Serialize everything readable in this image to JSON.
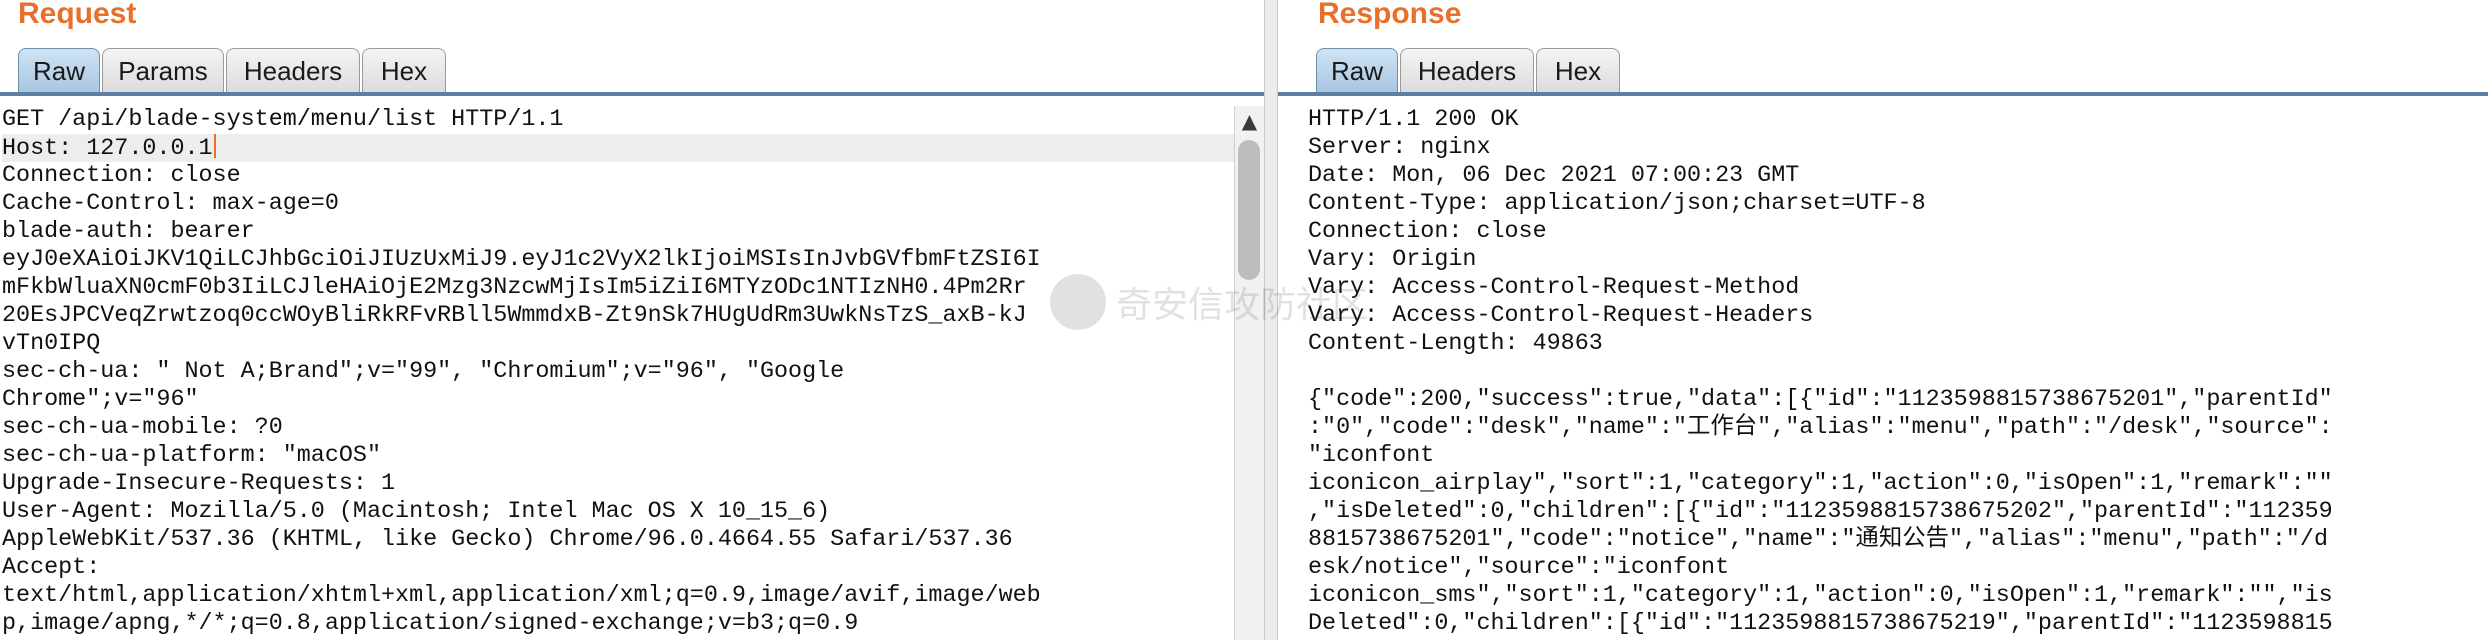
{
  "request": {
    "title": "Request",
    "tabs": [
      {
        "label": "Raw",
        "active": true
      },
      {
        "label": "Params",
        "active": false
      },
      {
        "label": "Headers",
        "active": false
      },
      {
        "label": "Hex",
        "active": false
      }
    ],
    "lines": [
      "GET /api/blade-system/menu/list HTTP/1.1",
      "Host: 127.0.0.1",
      "Connection: close",
      "Cache-Control: max-age=0",
      "blade-auth: bearer",
      "eyJ0eXAiOiJKV1QiLCJhbGciOiJIUzUxMiJ9.eyJ1c2VyX2lkIjoiMSIsInJvbGVfbmFtZSI6I",
      "mFkbWluaXN0cmF0b3IiLCJleHAiOjE2Mzg3NzcwMjIsIm5iZiI6MTYzODc1NTIzNH0.4Pm2Rr",
      "20EsJPCVeqZrwtzoq0ccWOyBliRkRFvRBll5WmmdxB-Zt9nSk7HUgUdRm3UwkNsTzS_axB-kJ",
      "vTn0IPQ",
      "sec-ch-ua: \" Not A;Brand\";v=\"99\", \"Chromium\";v=\"96\", \"Google",
      "Chrome\";v=\"96\"",
      "sec-ch-ua-mobile: ?0",
      "sec-ch-ua-platform: \"macOS\"",
      "Upgrade-Insecure-Requests: 1",
      "User-Agent: Mozilla/5.0 (Macintosh; Intel Mac OS X 10_15_6)",
      "AppleWebKit/537.36 (KHTML, like Gecko) Chrome/96.0.4664.55 Safari/537.36",
      "Accept:",
      "text/html,application/xhtml+xml,application/xml;q=0.9,image/avif,image/web",
      "p,image/apng,*/*;q=0.8,application/signed-exchange;v=b3;q=0.9"
    ],
    "highlighted_line": 1,
    "scroll_up_icon": "scroll-up-arrow-icon"
  },
  "response": {
    "title": "Response",
    "tabs": [
      {
        "label": "Raw",
        "active": true
      },
      {
        "label": "Headers",
        "active": false
      },
      {
        "label": "Hex",
        "active": false
      }
    ],
    "lines": [
      "HTTP/1.1 200 OK",
      "Server: nginx",
      "Date: Mon, 06 Dec 2021 07:00:23 GMT",
      "Content-Type: application/json;charset=UTF-8",
      "Connection: close",
      "Vary: Origin",
      "Vary: Access-Control-Request-Method",
      "Vary: Access-Control-Request-Headers",
      "Content-Length: 49863",
      "",
      "{\"code\":200,\"success\":true,\"data\":[{\"id\":\"1123598815738675201\",\"parentId\"",
      ":\"0\",\"code\":\"desk\",\"name\":\"工作台\",\"alias\":\"menu\",\"path\":\"/desk\",\"source\":",
      "\"iconfont",
      "iconicon_airplay\",\"sort\":1,\"category\":1,\"action\":0,\"isOpen\":1,\"remark\":\"\"",
      ",\"isDeleted\":0,\"children\":[{\"id\":\"1123598815738675202\",\"parentId\":\"112359",
      "8815738675201\",\"code\":\"notice\",\"name\":\"通知公告\",\"alias\":\"menu\",\"path\":\"/d",
      "esk/notice\",\"source\":\"iconfont",
      "iconicon_sms\",\"sort\":1,\"category\":1,\"action\":0,\"isOpen\":1,\"remark\":\"\",\"is",
      "Deleted\":0,\"children\":[{\"id\":\"1123598815738675219\",\"parentId\":\"1123598815"
    ]
  },
  "watermark": {
    "text": "奇安信攻防社区"
  },
  "colors": {
    "title": "#e8702a",
    "tab_active": "#a9c6e0",
    "tab_inactive": "#dcdcdc",
    "tab_underline": "#5c7fa3",
    "caret": "#e8702a"
  }
}
